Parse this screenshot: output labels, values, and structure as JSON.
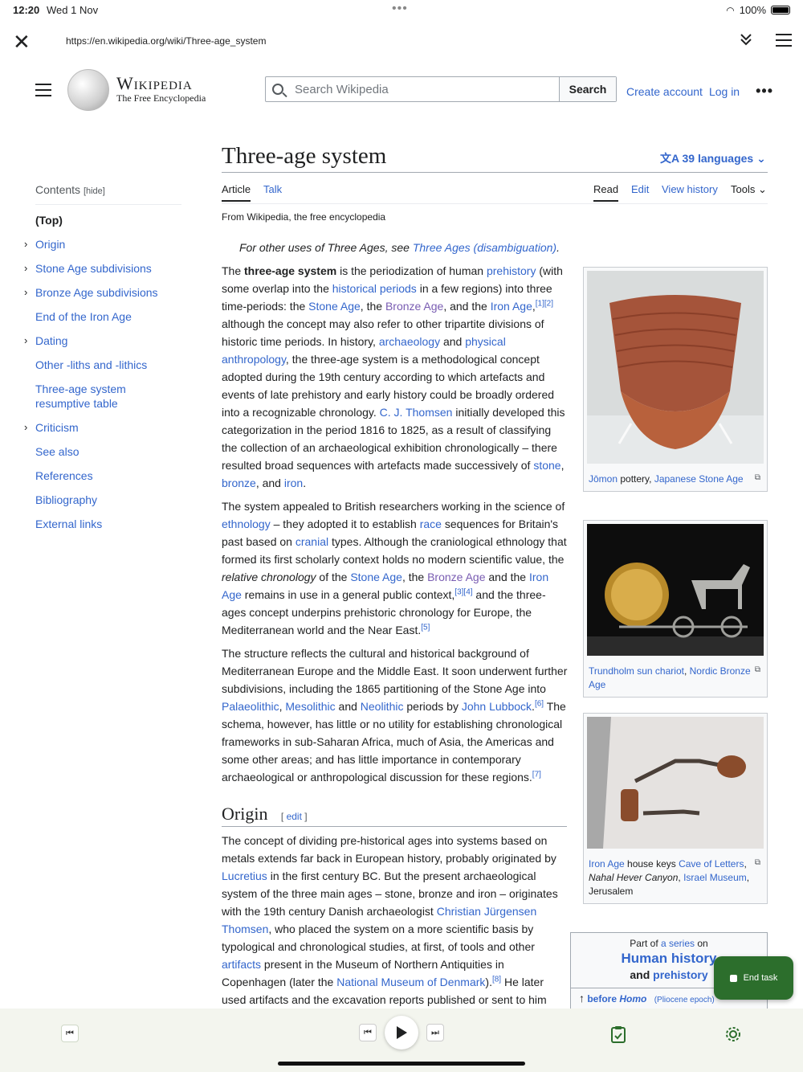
{
  "status": {
    "time": "12:20",
    "date": "Wed 1 Nov",
    "battery": "100%"
  },
  "browser": {
    "url": "https://en.wikipedia.org/wiki/Three-age_system"
  },
  "header": {
    "wordmark": "Wikipedia",
    "tagline": "The Free Encyclopedia",
    "search_placeholder": "Search Wikipedia",
    "search_button": "Search",
    "create_account": "Create account",
    "log_in": "Log in"
  },
  "toc": {
    "heading": "Contents",
    "hide": "[hide]",
    "items": [
      {
        "label": "(Top)",
        "bold": true,
        "chev": false
      },
      {
        "label": "Origin",
        "chev": true
      },
      {
        "label": "Stone Age subdivisions",
        "chev": true
      },
      {
        "label": "Bronze Age subdivisions",
        "chev": true
      },
      {
        "label": "End of the Iron Age",
        "chev": false
      },
      {
        "label": "Dating",
        "chev": true
      },
      {
        "label": "Other -liths and -lithics",
        "chev": false
      },
      {
        "label": "Three-age system resumptive table",
        "chev": false
      },
      {
        "label": "Criticism",
        "chev": true
      },
      {
        "label": "See also",
        "chev": false
      },
      {
        "label": "References",
        "chev": false
      },
      {
        "label": "Bibliography",
        "chev": false
      },
      {
        "label": "External links",
        "chev": false
      }
    ]
  },
  "article": {
    "title": "Three-age system",
    "languages": "39 languages",
    "tabs": {
      "article": "Article",
      "talk": "Talk",
      "read": "Read",
      "edit": "Edit",
      "history": "View history",
      "tools": "Tools"
    },
    "from": "From Wikipedia, the free encyclopedia",
    "hatnote_pre": "For other uses of Three Ages, see ",
    "hatnote_link": "Three Ages (disambiguation)",
    "hatnote_post": ".",
    "origin_heading": "Origin",
    "origin_edit": "edit"
  },
  "figures": [
    {
      "caption_link1": "Jōmon",
      "caption_mid": " pottery, ",
      "caption_link2": "Japanese Stone Age"
    },
    {
      "caption_link1": "Trundholm sun chariot",
      "caption_mid": ", ",
      "caption_link2": "Nordic Bronze Age"
    },
    {
      "caption_link1": "Iron Age",
      "caption_mid": " house keys ",
      "caption_link2": "Cave of Letters",
      "caption_tail1": "Nahal Hever Canyon",
      "caption_tail2": "Israel Museum",
      "caption_tail3": "Jerusalem"
    }
  ],
  "series": {
    "part_of": "Part of ",
    "a_series": "a series",
    "on": " on",
    "h1": "Human history",
    "and": "and ",
    "prehistory": "prehistory",
    "before": "before ",
    "homo": "Homo",
    "pliocene": "(Pliocene epoch)"
  },
  "overlay": {
    "end_task": "End task"
  }
}
